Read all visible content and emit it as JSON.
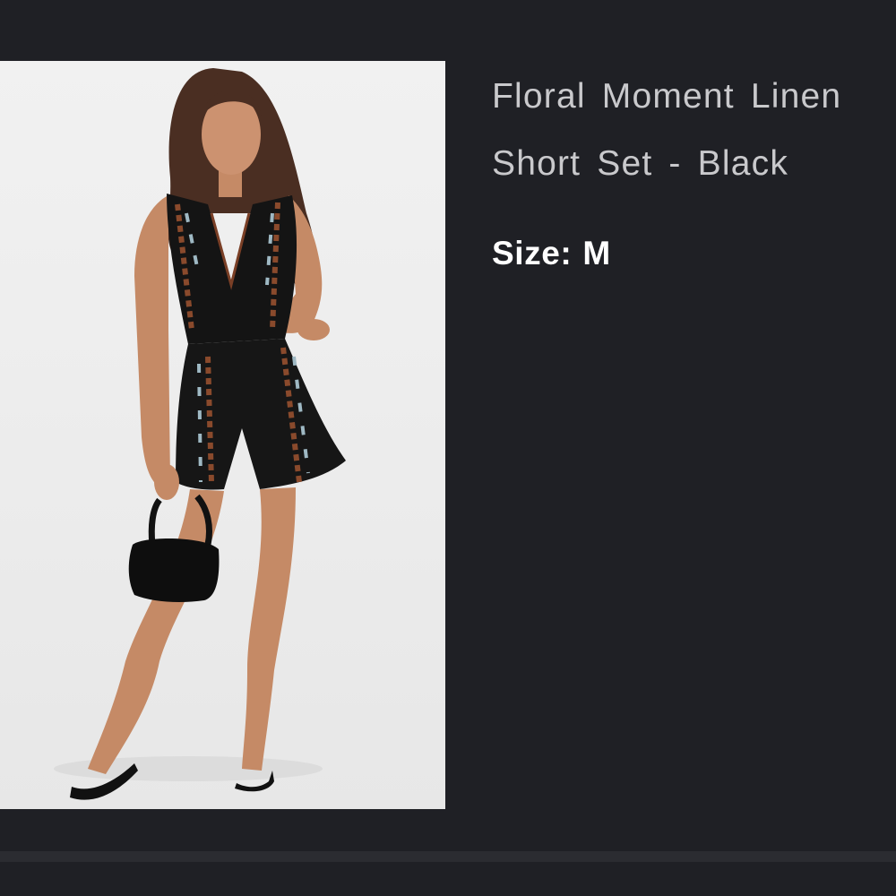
{
  "product": {
    "image_alt": "Model wearing black embroidered linen short set",
    "title": "Floral Moment Linen Short Set - Black",
    "size_label": "Size:",
    "size_value": "M"
  }
}
